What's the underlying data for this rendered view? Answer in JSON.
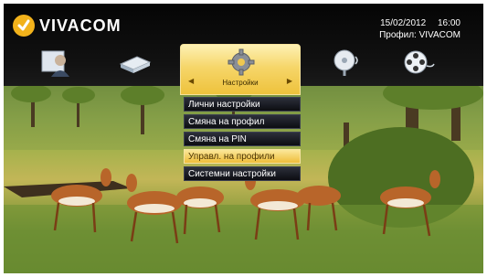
{
  "brand": {
    "name": "VIVACOM",
    "accent": "#f2b21b"
  },
  "status": {
    "date": "15/02/2012",
    "time": "16:00",
    "profile_label": "Профил: VIVACOM"
  },
  "nav": {
    "items": [
      {
        "icon": "user-icon"
      },
      {
        "icon": "book-icon"
      },
      {
        "icon": "settings-gear-icon",
        "label": "Настройки",
        "selected": true
      },
      {
        "icon": "satellite-dish-icon"
      },
      {
        "icon": "film-reel-icon"
      }
    ]
  },
  "menu": {
    "items": [
      {
        "label": "Лични настройки"
      },
      {
        "label": "Смяна на профил"
      },
      {
        "label": "Смяна на PIN"
      },
      {
        "label": "Управл. на профили",
        "active": true
      },
      {
        "label": "Системни настройки"
      }
    ]
  }
}
